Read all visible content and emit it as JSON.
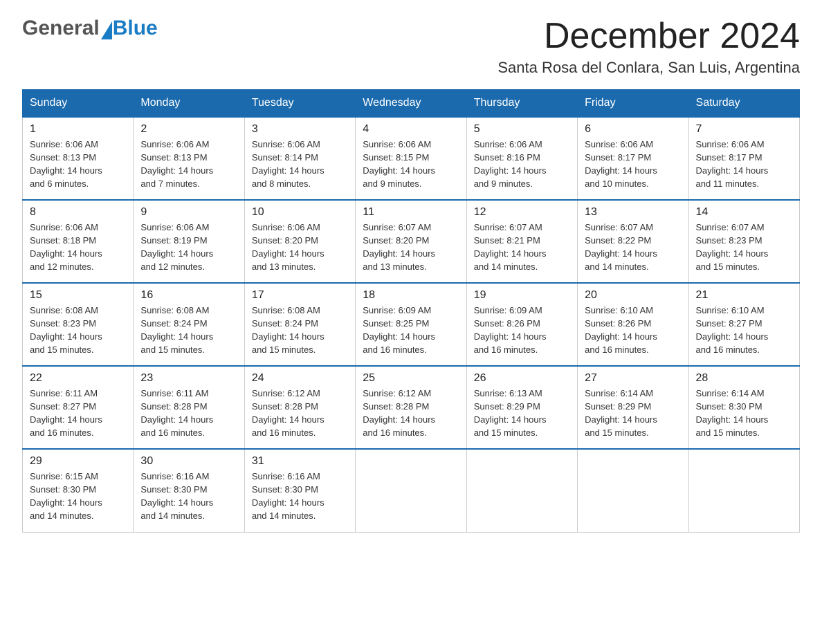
{
  "header": {
    "logo_general": "General",
    "logo_blue": "Blue",
    "month_title": "December 2024",
    "location": "Santa Rosa del Conlara, San Luis, Argentina"
  },
  "days_of_week": [
    "Sunday",
    "Monday",
    "Tuesday",
    "Wednesday",
    "Thursday",
    "Friday",
    "Saturday"
  ],
  "weeks": [
    [
      {
        "day": "1",
        "sunrise": "6:06 AM",
        "sunset": "8:13 PM",
        "daylight": "14 hours and 6 minutes."
      },
      {
        "day": "2",
        "sunrise": "6:06 AM",
        "sunset": "8:13 PM",
        "daylight": "14 hours and 7 minutes."
      },
      {
        "day": "3",
        "sunrise": "6:06 AM",
        "sunset": "8:14 PM",
        "daylight": "14 hours and 8 minutes."
      },
      {
        "day": "4",
        "sunrise": "6:06 AM",
        "sunset": "8:15 PM",
        "daylight": "14 hours and 9 minutes."
      },
      {
        "day": "5",
        "sunrise": "6:06 AM",
        "sunset": "8:16 PM",
        "daylight": "14 hours and 9 minutes."
      },
      {
        "day": "6",
        "sunrise": "6:06 AM",
        "sunset": "8:17 PM",
        "daylight": "14 hours and 10 minutes."
      },
      {
        "day": "7",
        "sunrise": "6:06 AM",
        "sunset": "8:17 PM",
        "daylight": "14 hours and 11 minutes."
      }
    ],
    [
      {
        "day": "8",
        "sunrise": "6:06 AM",
        "sunset": "8:18 PM",
        "daylight": "14 hours and 12 minutes."
      },
      {
        "day": "9",
        "sunrise": "6:06 AM",
        "sunset": "8:19 PM",
        "daylight": "14 hours and 12 minutes."
      },
      {
        "day": "10",
        "sunrise": "6:06 AM",
        "sunset": "8:20 PM",
        "daylight": "14 hours and 13 minutes."
      },
      {
        "day": "11",
        "sunrise": "6:07 AM",
        "sunset": "8:20 PM",
        "daylight": "14 hours and 13 minutes."
      },
      {
        "day": "12",
        "sunrise": "6:07 AM",
        "sunset": "8:21 PM",
        "daylight": "14 hours and 14 minutes."
      },
      {
        "day": "13",
        "sunrise": "6:07 AM",
        "sunset": "8:22 PM",
        "daylight": "14 hours and 14 minutes."
      },
      {
        "day": "14",
        "sunrise": "6:07 AM",
        "sunset": "8:23 PM",
        "daylight": "14 hours and 15 minutes."
      }
    ],
    [
      {
        "day": "15",
        "sunrise": "6:08 AM",
        "sunset": "8:23 PM",
        "daylight": "14 hours and 15 minutes."
      },
      {
        "day": "16",
        "sunrise": "6:08 AM",
        "sunset": "8:24 PM",
        "daylight": "14 hours and 15 minutes."
      },
      {
        "day": "17",
        "sunrise": "6:08 AM",
        "sunset": "8:24 PM",
        "daylight": "14 hours and 15 minutes."
      },
      {
        "day": "18",
        "sunrise": "6:09 AM",
        "sunset": "8:25 PM",
        "daylight": "14 hours and 16 minutes."
      },
      {
        "day": "19",
        "sunrise": "6:09 AM",
        "sunset": "8:26 PM",
        "daylight": "14 hours and 16 minutes."
      },
      {
        "day": "20",
        "sunrise": "6:10 AM",
        "sunset": "8:26 PM",
        "daylight": "14 hours and 16 minutes."
      },
      {
        "day": "21",
        "sunrise": "6:10 AM",
        "sunset": "8:27 PM",
        "daylight": "14 hours and 16 minutes."
      }
    ],
    [
      {
        "day": "22",
        "sunrise": "6:11 AM",
        "sunset": "8:27 PM",
        "daylight": "14 hours and 16 minutes."
      },
      {
        "day": "23",
        "sunrise": "6:11 AM",
        "sunset": "8:28 PM",
        "daylight": "14 hours and 16 minutes."
      },
      {
        "day": "24",
        "sunrise": "6:12 AM",
        "sunset": "8:28 PM",
        "daylight": "14 hours and 16 minutes."
      },
      {
        "day": "25",
        "sunrise": "6:12 AM",
        "sunset": "8:28 PM",
        "daylight": "14 hours and 16 minutes."
      },
      {
        "day": "26",
        "sunrise": "6:13 AM",
        "sunset": "8:29 PM",
        "daylight": "14 hours and 15 minutes."
      },
      {
        "day": "27",
        "sunrise": "6:14 AM",
        "sunset": "8:29 PM",
        "daylight": "14 hours and 15 minutes."
      },
      {
        "day": "28",
        "sunrise": "6:14 AM",
        "sunset": "8:30 PM",
        "daylight": "14 hours and 15 minutes."
      }
    ],
    [
      {
        "day": "29",
        "sunrise": "6:15 AM",
        "sunset": "8:30 PM",
        "daylight": "14 hours and 14 minutes."
      },
      {
        "day": "30",
        "sunrise": "6:16 AM",
        "sunset": "8:30 PM",
        "daylight": "14 hours and 14 minutes."
      },
      {
        "day": "31",
        "sunrise": "6:16 AM",
        "sunset": "8:30 PM",
        "daylight": "14 hours and 14 minutes."
      },
      null,
      null,
      null,
      null
    ]
  ],
  "labels": {
    "sunrise_prefix": "Sunrise: ",
    "sunset_prefix": "Sunset: ",
    "daylight_prefix": "Daylight: "
  }
}
